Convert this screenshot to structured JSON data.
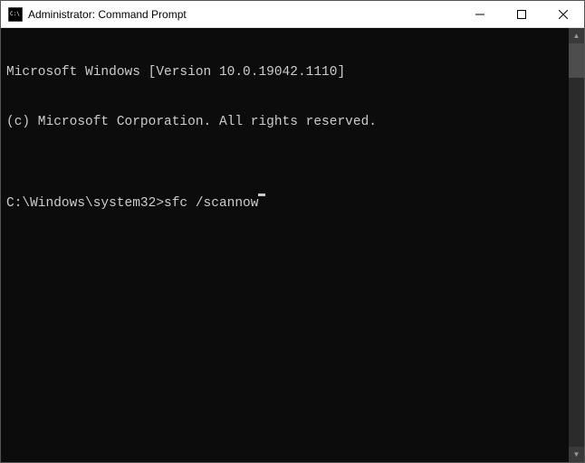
{
  "window": {
    "title": "Administrator: Command Prompt"
  },
  "terminal": {
    "line1": "Microsoft Windows [Version 10.0.19042.1110]",
    "line2": "(c) Microsoft Corporation. All rights reserved.",
    "blank": "",
    "prompt": "C:\\Windows\\system32>",
    "command": "sfc /scannow"
  }
}
